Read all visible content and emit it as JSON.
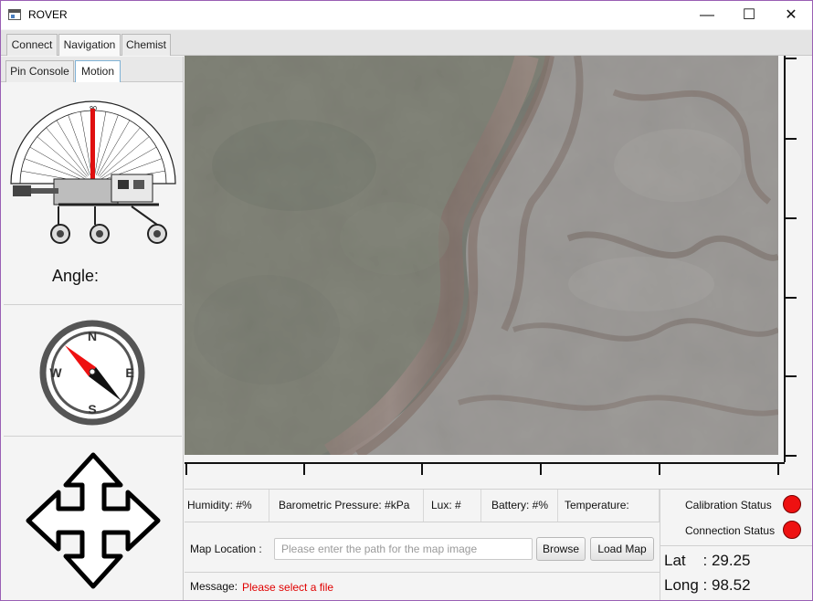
{
  "window": {
    "title": "ROVER"
  },
  "main_tabs": [
    "Connect",
    "Navigation",
    "Chemist"
  ],
  "sub_tabs": [
    "Pin Console",
    "Motion"
  ],
  "motion": {
    "angle_label": "Angle:",
    "protractor_value": "90"
  },
  "compass": {
    "n": "N",
    "s": "S",
    "e": "E",
    "w": "W"
  },
  "sensors": {
    "humidity": "Humidity: #%",
    "pressure": "Barometric Pressure: #kPa",
    "lux": "Lux: #",
    "battery": "Battery: #%",
    "temperature": "Temperature:"
  },
  "map_location": {
    "label": "Map Location :",
    "placeholder": "Please enter the path for the map image",
    "browse": "Browse",
    "load": "Load Map"
  },
  "message": {
    "label": "Message:",
    "text": "Please select a file",
    "color": "#e00000"
  },
  "status": {
    "calibration": "Calibration Status",
    "connection": "Connection Status",
    "indicator_color": "#ee1111"
  },
  "coords": {
    "lat": "Lat    : 29.25",
    "long": "Long : 98.52"
  }
}
